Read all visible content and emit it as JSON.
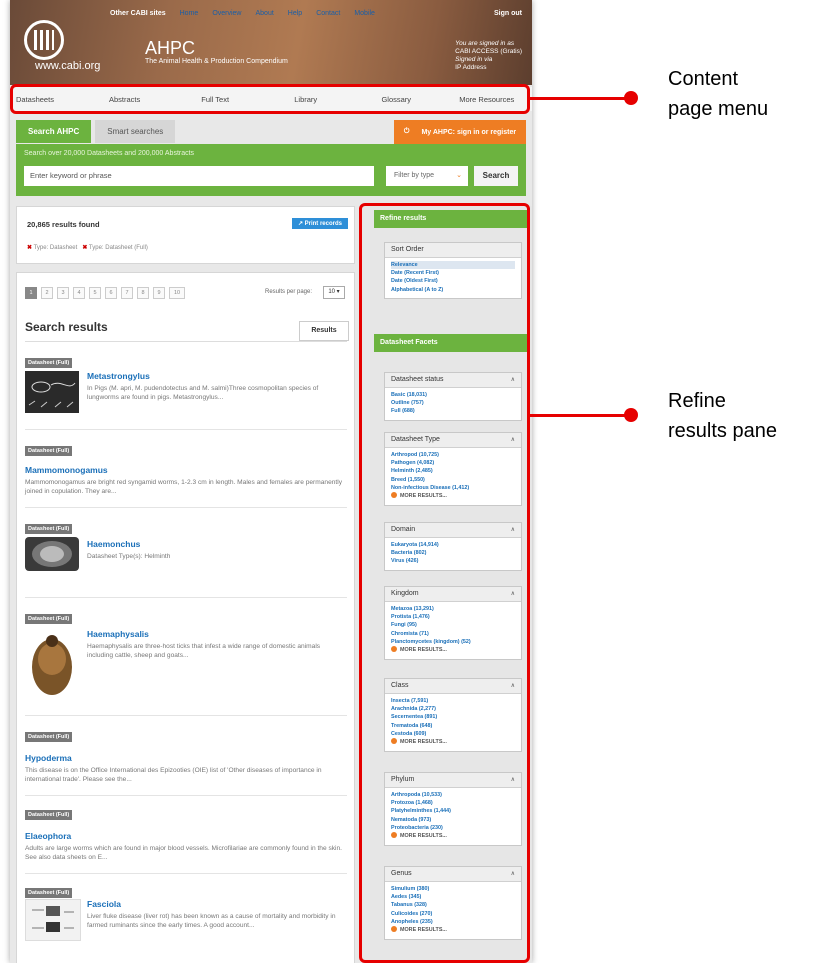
{
  "header": {
    "top_nav": [
      "Other CABI sites",
      "Home",
      "Overview",
      "About",
      "Help",
      "Contact",
      "Mobile"
    ],
    "sign_out": "Sign out",
    "logo_url": "www.cabi.org",
    "app_title": "AHPC",
    "app_subtitle": "The Animal Health & Production Compendium",
    "signed_in": [
      "You are signed in as",
      "CABI ACCESS (Gratis)",
      "Signed in via",
      "IP Address"
    ]
  },
  "content_menu": [
    "Datasheets",
    "Abstracts",
    "Full Text",
    "Library",
    "Glossary",
    "More Resources"
  ],
  "search": {
    "tab_active": "Search AHPC",
    "tab_other": "Smart searches",
    "my_ahpc": "My AHPC: sign in or register",
    "hint": "Search over 20,000 Datasheets and 200,000 Abstracts",
    "placeholder": "Enter keyword or phrase",
    "filter": "Filter by type",
    "button": "Search"
  },
  "summary": {
    "count": "20,865 results found",
    "print": "Print records",
    "filter1": "Type: Datasheet",
    "filter2": "Type: Datasheet (Full)"
  },
  "results_panel": {
    "pages": [
      "1",
      "2",
      "3",
      "4",
      "5",
      "6",
      "7",
      "8",
      "9",
      "10"
    ],
    "per_page_label": "Results per page:",
    "per_page_value": "10",
    "title": "Search results",
    "tab": "Results",
    "items": [
      {
        "tag": "Datasheet (Full)",
        "title": "Metastrongylus",
        "desc": "In Pigs (M. apri, M. pudendotectus and M. salmi)Three cosmopolitan species of lungworms are found in pigs. Metastrongylus..."
      },
      {
        "tag": "Datasheet (Full)",
        "title": "Mammomonogamus",
        "desc": "Mammomonogamus are bright red syngamid worms, 1-2.3 cm in length. Males and females are permanently joined in copulation. They are..."
      },
      {
        "tag": "Datasheet (Full)",
        "title": "Haemonchus",
        "desc": "Datasheet Type(s): Helminth"
      },
      {
        "tag": "Datasheet (Full)",
        "title": "Haemaphysalis",
        "desc": "Haemaphysalis are three-host ticks that infest a wide range of domestic animals including cattle, sheep and goats..."
      },
      {
        "tag": "Datasheet (Full)",
        "title": "Hypoderma",
        "desc": "This disease is on the Office International des Epizooties (OIE) list of 'Other diseases of importance in international trade'. Please see the..."
      },
      {
        "tag": "Datasheet (Full)",
        "title": "Elaeophora",
        "desc": "Adults are large worms which are found in major blood vessels. Microfilariae are commonly found in the skin. See also data sheets on E..."
      },
      {
        "tag": "Datasheet (Full)",
        "title": "Fasciola",
        "desc": "Liver fluke disease (liver rot) has been known as a cause of mortality and morbidity in farmed ruminants since the early times. A good account..."
      }
    ]
  },
  "refine": {
    "header": "Refine results",
    "sort_title": "Sort Order",
    "sort_items": [
      "Relevance",
      "Date (Recent First)",
      "Date (Oldest First)",
      "Alphabetical (A to Z)"
    ],
    "facets_header": "Datasheet Facets",
    "more": "MORE RESULTS...",
    "facets": [
      {
        "title": "Datasheet status",
        "items": [
          "Basic (18,031)",
          "Outline (757)",
          "Full (688)"
        ]
      },
      {
        "title": "Datasheet Type",
        "items": [
          "Arthropod (10,725)",
          "Pathogen (4,082)",
          "Helminth (2,485)",
          "Breed (1,550)",
          "Non-infectious Disease (1,412)"
        ]
      },
      {
        "title": "Domain",
        "items": [
          "Eukaryota (14,914)",
          "Bacteria (802)",
          "Virus (426)"
        ]
      },
      {
        "title": "Kingdom",
        "items": [
          "Metazoa (13,291)",
          "Protista (1,476)",
          "Fungi (95)",
          "Chromista (71)",
          "Planctomycetes (kingdom) (52)"
        ]
      },
      {
        "title": "Class",
        "items": [
          "Insecta (7,591)",
          "Arachnida (2,277)",
          "Secernentea (891)",
          "Trematoda (648)",
          "Cestoda (609)"
        ]
      },
      {
        "title": "Phylum",
        "items": [
          "Arthropoda (10,533)",
          "Protozoa (1,468)",
          "Platyhelminthes (1,444)",
          "Nematoda (973)",
          "Proteobacteria (230)"
        ]
      },
      {
        "title": "Genus",
        "items": [
          "Simulium (380)",
          "Aedes (345)",
          "Tabanus (328)",
          "Culicoides (270)",
          "Anopheles (235)"
        ]
      }
    ]
  },
  "annotations": {
    "content_menu": [
      "Content",
      "page menu"
    ],
    "refine_pane": [
      "Refine",
      "results pane"
    ]
  },
  "colors": {
    "green": "#6cb33f",
    "orange": "#ee7d23",
    "annotation_red": "#e60000",
    "link_blue": "#1a6fb8"
  }
}
